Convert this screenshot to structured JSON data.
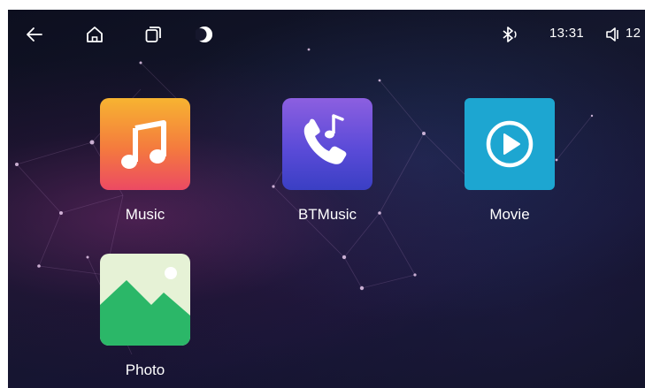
{
  "status_bar": {
    "icons": {
      "back": "back-arrow-icon",
      "home": "home-icon",
      "recents": "recent-apps-icon",
      "night_mode": "moon-icon",
      "bluetooth": "bluetooth-audio-icon",
      "volume": "speaker-icon"
    },
    "time": "13:31",
    "volume_level": "12"
  },
  "apps": [
    {
      "label": "Music",
      "icon": "music-note-icon",
      "colors": [
        "#f7b431",
        "#ec4a63"
      ]
    },
    {
      "label": "BTMusic",
      "icon": "phone-music-icon",
      "colors": [
        "#8c5fe0",
        "#3a3fc4"
      ]
    },
    {
      "label": "Movie",
      "icon": "play-circle-icon",
      "colors": [
        "#1da6d1"
      ]
    },
    {
      "label": "Photo",
      "icon": "landscape-image-icon",
      "colors": [
        "#e6f2d6",
        "#2db86a"
      ]
    }
  ]
}
